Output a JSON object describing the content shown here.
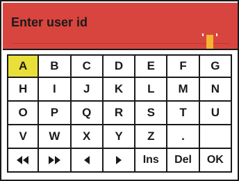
{
  "header": {
    "title": "Enter user id",
    "background": "#d8453e",
    "cursor_color": "#f4b331"
  },
  "selection_color": "#e9df3a",
  "keyboard": {
    "rows": [
      [
        "A",
        "B",
        "C",
        "D",
        "E",
        "F",
        "G"
      ],
      [
        "H",
        "I",
        "J",
        "K",
        "L",
        "M",
        "N"
      ],
      [
        "O",
        "P",
        "Q",
        "R",
        "S",
        "T",
        "U"
      ],
      [
        "V",
        "W",
        "X",
        "Y",
        "Z",
        "."
      ],
      [
        "rewind-icon",
        "fast-forward-icon",
        "cursor-left-icon",
        "cursor-right-icon",
        "Ins",
        "Del",
        "OK"
      ]
    ]
  }
}
